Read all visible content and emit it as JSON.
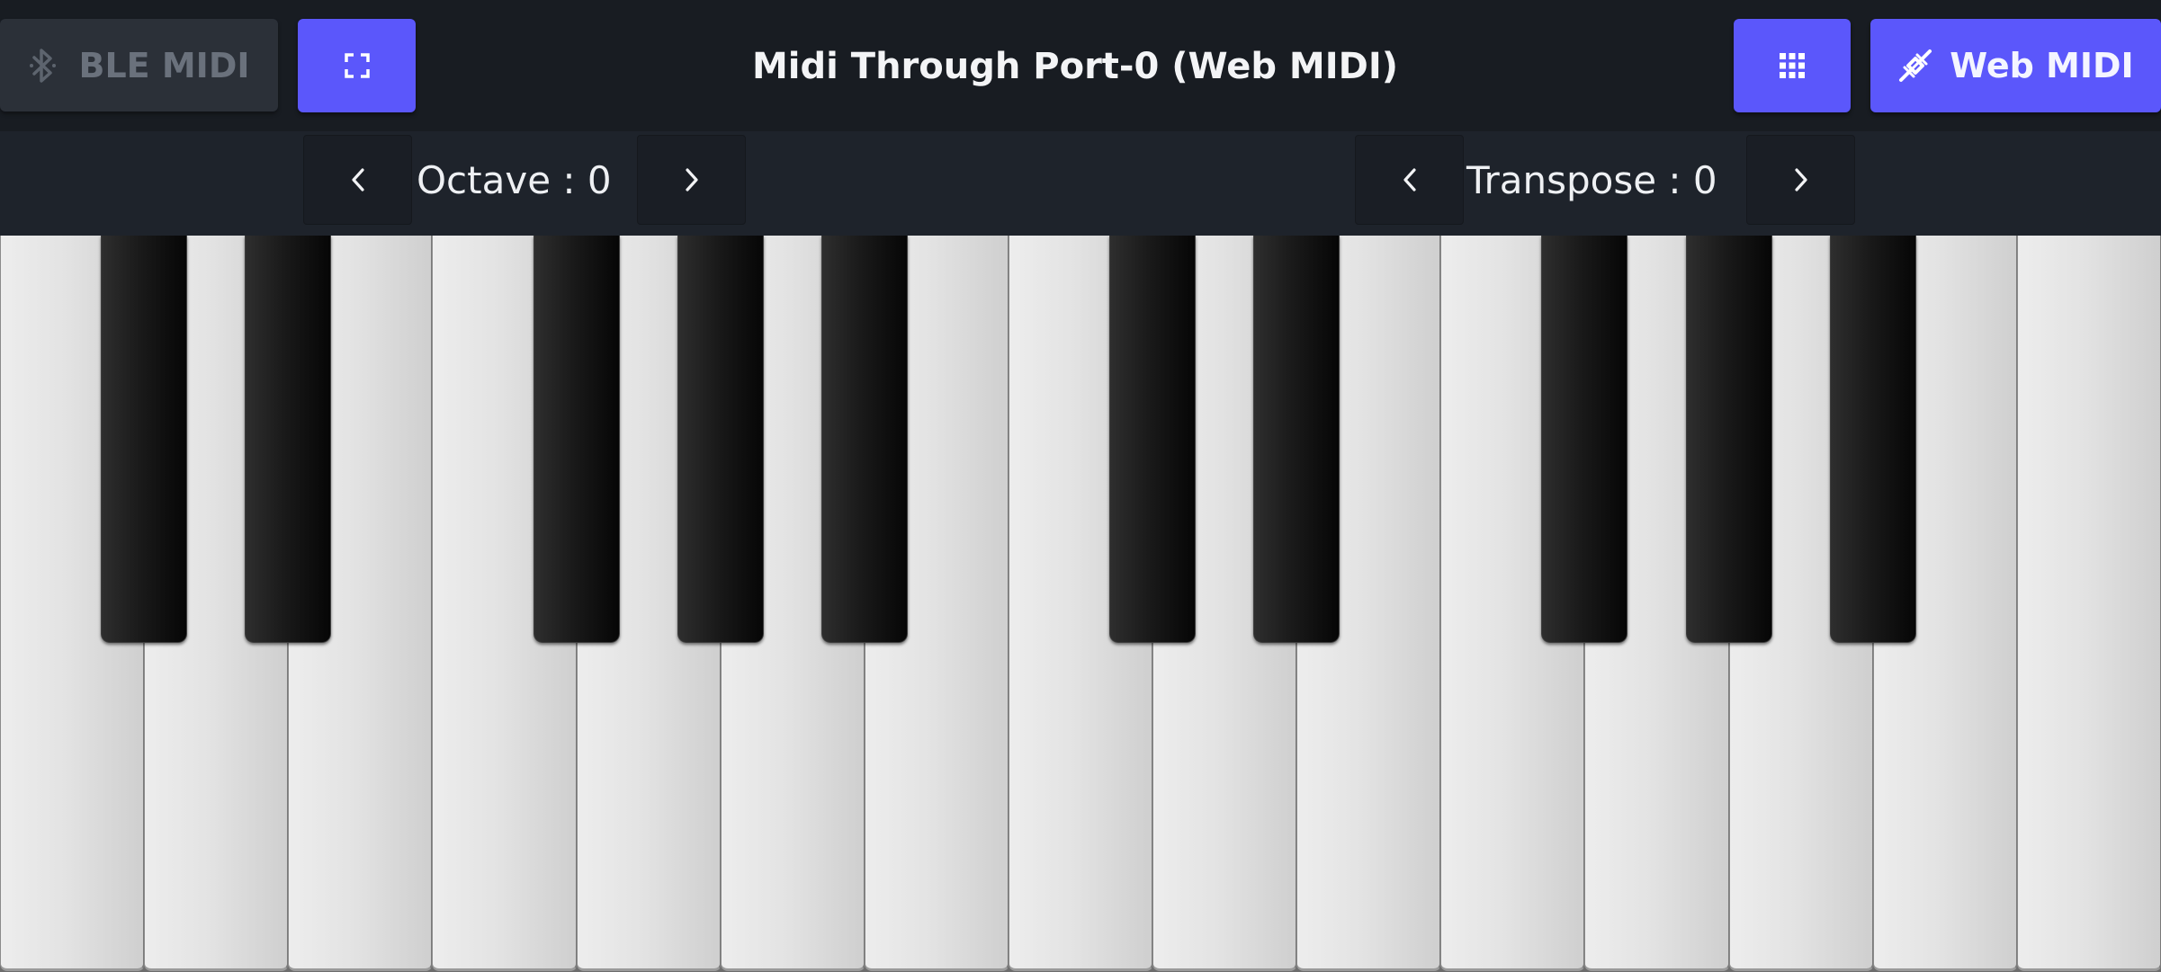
{
  "header": {
    "ble_button_label": "BLE MIDI",
    "ble_icon": "bluetooth-icon",
    "fullscreen_icon": "fullscreen-icon",
    "title": "Midi Through Port-0 (Web MIDI)",
    "grid_icon": "grid-icon",
    "webmidi_icon": "midi-cable-icon",
    "webmidi_button_label": "Web MIDI"
  },
  "controls": {
    "octave_label": "Octave : 0",
    "transpose_label": "Transpose : 0",
    "prev_icon": "chevron-left-icon",
    "next_icon": "chevron-right-icon"
  },
  "keyboard": {
    "white_key_count": 15,
    "black_key_count": 10
  },
  "colors": {
    "accent": "#5b57fb",
    "header_bg": "#181c22",
    "controlbar_bg": "#1e232b",
    "disabled_button": "#2b3038"
  }
}
